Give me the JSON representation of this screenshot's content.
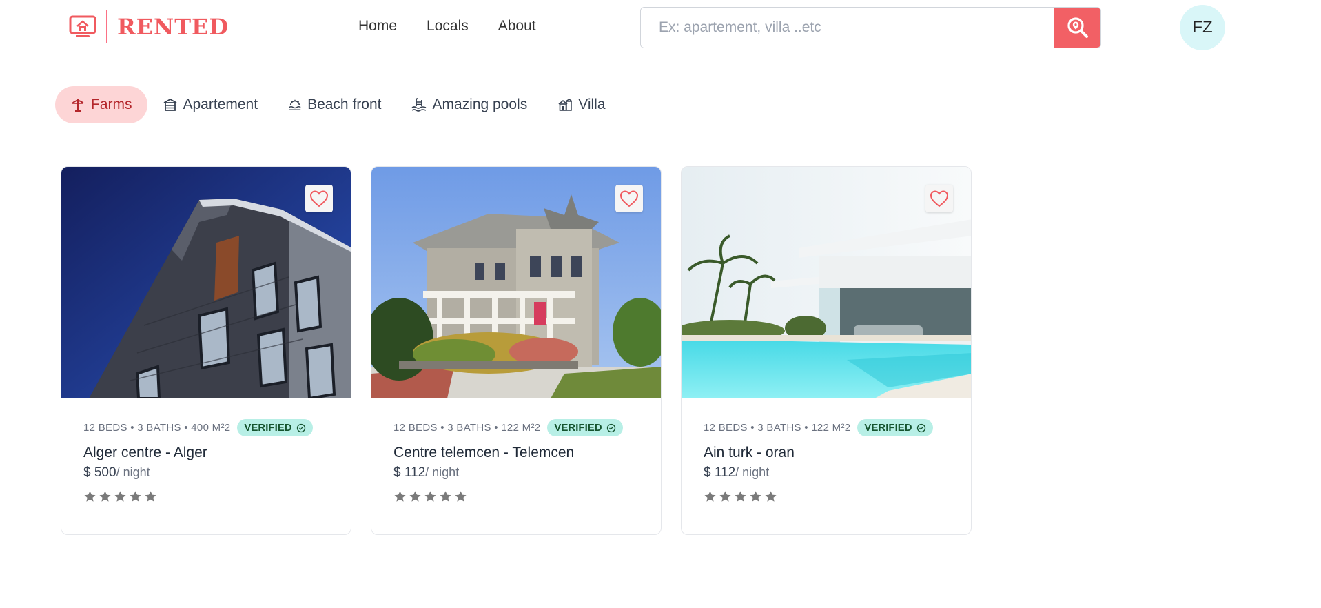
{
  "brand": {
    "name": "RENTED"
  },
  "nav": {
    "home": "Home",
    "locals": "Locals",
    "about": "About"
  },
  "search": {
    "placeholder": "Ex: apartement, villa ..etc"
  },
  "user": {
    "initials": "FZ"
  },
  "categories": [
    {
      "label": "Farms",
      "icon": "farm-icon",
      "active": true
    },
    {
      "label": "Apartement",
      "icon": "apartment-icon",
      "active": false
    },
    {
      "label": "Beach front",
      "icon": "beach-icon",
      "active": false
    },
    {
      "label": "Amazing pools",
      "icon": "pool-icon",
      "active": false
    },
    {
      "label": "Villa",
      "icon": "villa-icon",
      "active": false
    }
  ],
  "listings": [
    {
      "meta": "12 BEDS • 3 BATHS • 400 M²2",
      "badge": "VERIFIED",
      "title": "Alger centre - Alger",
      "currency": "$",
      "price": "500",
      "per": "/ night",
      "rating": 5,
      "image": "modern-building-photo"
    },
    {
      "meta": "12 BEDS • 3 BATHS • 122 M²2",
      "badge": "VERIFIED",
      "title": "Centre telemcen - Telemcen",
      "currency": "$",
      "price": "112",
      "per": "/ night",
      "rating": 5,
      "image": "victorian-house-photo"
    },
    {
      "meta": "12 BEDS • 3 BATHS • 122 M²2",
      "badge": "VERIFIED",
      "title": "Ain turk - oran",
      "currency": "$",
      "price": "112",
      "per": "/ night",
      "rating": 5,
      "image": "pool-villa-photo"
    }
  ],
  "colors": {
    "accent": "#f05a5f",
    "activeCategory": "#fdd5d6",
    "badge": "#b8efe6",
    "avatar": "#d9f6f8"
  }
}
